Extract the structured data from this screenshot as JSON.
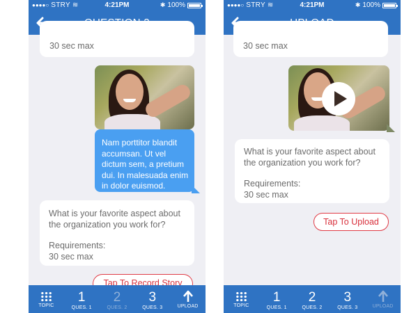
{
  "status_bar": {
    "carrier": "STRY",
    "time": "4:21PM",
    "battery": "100%"
  },
  "left_screen": {
    "title": "QUESTION 2",
    "top_bubble": {
      "requirements_value": "30 sec max"
    },
    "reply_bubble_text": "Nam porttitor blandit accumsan. Ut vel dictum sem, a pretium dui. In malesuada enim in dolor euismod.",
    "question_bubble": {
      "question": "What is your favorite aspect about the organization you work for?",
      "requirements_label": "Requirements:",
      "requirements_value": "30 sec max"
    },
    "action_button": "Tap To Record Story"
  },
  "right_screen": {
    "title": "UPLOAD",
    "top_bubble": {
      "requirements_value": "30 sec max"
    },
    "question_bubble": {
      "question": "What is your favorite aspect about the organization you work for?",
      "requirements_label": "Requirements:",
      "requirements_value": "30 sec max"
    },
    "action_button": "Tap To Upload"
  },
  "tabs": [
    {
      "num": "",
      "label": "TOPIC",
      "icon": "grid-icon"
    },
    {
      "num": "1",
      "label": "QUES. 1"
    },
    {
      "num": "2",
      "label": "QUES. 2"
    },
    {
      "num": "3",
      "label": "QUES. 3"
    },
    {
      "num": "",
      "label": "UPLOAD",
      "icon": "upload-arrow-icon"
    }
  ],
  "colors": {
    "header_blue": "#2f73c3",
    "reply_bubble": "#4a9ff1",
    "action_red": "#e03a45",
    "background": "#efeff4"
  }
}
